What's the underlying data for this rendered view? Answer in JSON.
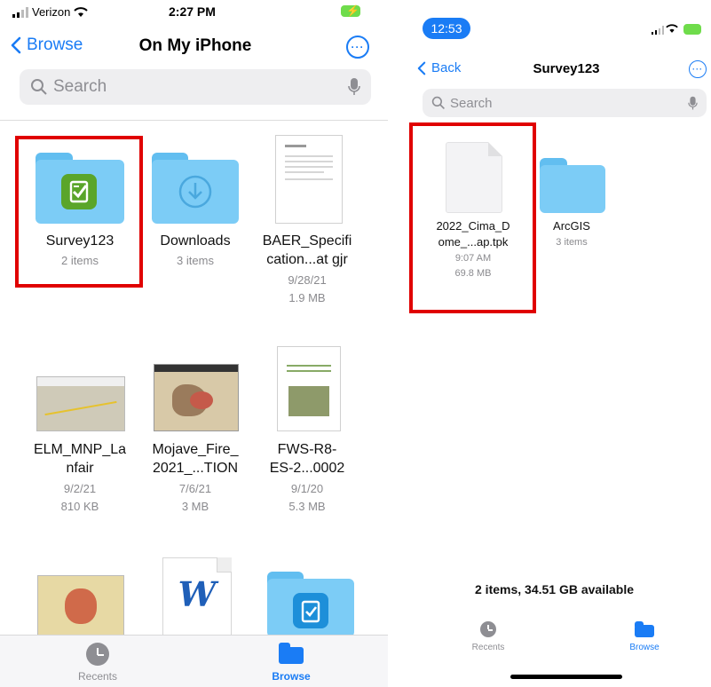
{
  "left": {
    "status": {
      "carrier": "Verizon",
      "time": "2:27 PM"
    },
    "nav": {
      "back_label": "Browse",
      "title": "On My iPhone",
      "more": "···"
    },
    "search": {
      "placeholder": "Search"
    },
    "items": [
      {
        "name": "Survey123",
        "meta": "2 items"
      },
      {
        "name": "Downloads",
        "meta": "3 items"
      },
      {
        "name_line1": "BAER_Specifi",
        "name_line2": "cation...at gjr",
        "date": "9/28/21",
        "size": "1.9 MB"
      },
      {
        "name_line1": "ELM_MNP_La",
        "name_line2": "nfair",
        "date": "9/2/21",
        "size": "810 KB"
      },
      {
        "name_line1": "Mojave_Fire_",
        "name_line2": "2021_...TION",
        "date": "7/6/21",
        "size": "3 MB"
      },
      {
        "name_line1": "FWS-R8-",
        "name_line2": "ES-2...0002",
        "date": "9/1/20",
        "size": "5.3 MB"
      }
    ],
    "word_glyph": "W",
    "tabbar": {
      "recents": "Recents",
      "browse": "Browse"
    }
  },
  "right": {
    "status": {
      "time": "12:53"
    },
    "nav": {
      "back_label": "Back",
      "title": "Survey123",
      "more": "···"
    },
    "search": {
      "placeholder": "Search"
    },
    "items": [
      {
        "name_line1": "2022_Cima_D",
        "name_line2": "ome_...ap.tpk",
        "time": "9:07 AM",
        "size": "69.8 MB"
      },
      {
        "name": "ArcGIS",
        "meta": "3 items"
      }
    ],
    "footer": "2 items, 34.51 GB available",
    "tabbar": {
      "recents": "Recents",
      "browse": "Browse"
    }
  },
  "colors": {
    "accent": "#1a7cf5",
    "folder": "#7cccf6",
    "highlight": "#e00000",
    "survey_green": "#5aa52a"
  }
}
